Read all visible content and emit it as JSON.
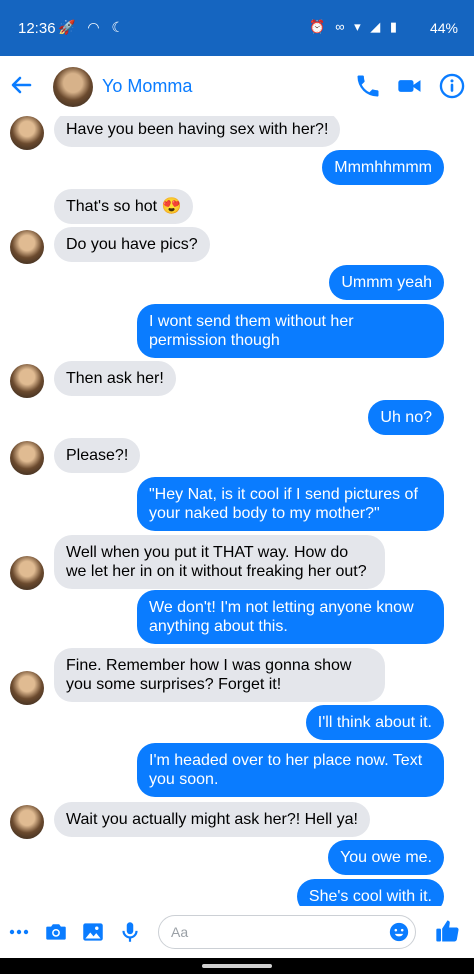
{
  "status": {
    "time": "12:36",
    "battery": "44%"
  },
  "header": {
    "contact_name": "Yo Momma"
  },
  "composer": {
    "placeholder": "Aa"
  },
  "colors": {
    "accent": "#0a7cff",
    "statusbar": "#1565c0",
    "incoming_bubble": "#e4e6eb"
  },
  "messages": [
    {
      "dir": "in",
      "text": "Have you been having sex with her?!"
    },
    {
      "dir": "out",
      "text": "Mmmhhmmm"
    },
    {
      "dir": "in",
      "text": "That's so hot 😍"
    },
    {
      "dir": "in",
      "text": "Do you have pics?"
    },
    {
      "dir": "out",
      "text": "Ummm yeah"
    },
    {
      "dir": "out",
      "text": "I wont send them without her permission though"
    },
    {
      "dir": "in",
      "text": "Then ask her!"
    },
    {
      "dir": "out",
      "text": "Uh no?"
    },
    {
      "dir": "in",
      "text": "Please?!"
    },
    {
      "dir": "out",
      "text": "\"Hey Nat, is it cool if I send pictures of your naked body to my mother?\""
    },
    {
      "dir": "in",
      "text": "Well when you put it THAT way. How do we let her in on it without freaking her out?"
    },
    {
      "dir": "out",
      "text": "We don't! I'm not letting anyone know anything about this."
    },
    {
      "dir": "in",
      "text": "Fine. Remember how I was gonna show you some surprises? Forget it!"
    },
    {
      "dir": "out",
      "text": "I'll think about it."
    },
    {
      "dir": "out",
      "text": "I'm headed over to her place now. Text you soon."
    },
    {
      "dir": "in",
      "text": "Wait you actually might ask her?! Hell ya!"
    },
    {
      "dir": "out",
      "text": "You owe me."
    },
    {
      "dir": "out",
      "text": "She's cool with it."
    }
  ]
}
